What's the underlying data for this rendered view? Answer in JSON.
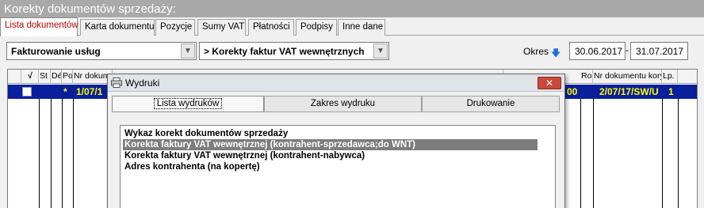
{
  "window": {
    "title": "Korekty dokumentów sprzedaży:"
  },
  "tabs": [
    {
      "label": "Lista dokumentów",
      "active": true
    },
    {
      "label": "Karta dokumentu"
    },
    {
      "label": "Pozycje"
    },
    {
      "label": "Sumy VAT"
    },
    {
      "label": "Płatności"
    },
    {
      "label": "Podpisy"
    },
    {
      "label": "Inne dane"
    }
  ],
  "filters": {
    "type_select": "Fakturowanie usług",
    "doc_select": "> Korekty faktur VAT wewnętrznych"
  },
  "period": {
    "label": "Okres",
    "from": "30.06.2017",
    "sep": "-",
    "to": "31.07.2017"
  },
  "grid": {
    "headers": [
      "√",
      "St",
      "Dé",
      "Po",
      "Nr dokum",
      "Ro:",
      "Nr dokumentu kory",
      "Lp."
    ],
    "row": {
      "star": "*",
      "date": "1/07/1",
      "ro": "00",
      "nr_kor": "2/07/17/SW/U",
      "lp": "1"
    }
  },
  "dialog": {
    "title": "Wydruki",
    "close": "✕",
    "tabs": [
      "Lista wydruków",
      "Zakres wydruku",
      "Drukowanie"
    ],
    "items": [
      "Wykaz korekt dokumentów sprzedaży",
      "Korekta faktury VAT wewnętrznej (kontrahent-sprzedawca;do WNT)",
      "Korekta faktury VAT wewnętrznej (kontrahent-nabywca)",
      "Adres kontrahenta (na kopertę)"
    ],
    "selected_index": 1
  },
  "icons": {
    "dropdown": "chevron-down-icon",
    "sort": "arrow-down-icon",
    "printer": "printer-icon",
    "close": "close-icon"
  },
  "colors": {
    "title_bar": "#a9a9a9",
    "active_tab_text": "#c00000",
    "selected_row_bg": "#0a1f9c",
    "selected_row_text": "#ffff00",
    "dialog_close": "#c9483a",
    "list_selected": "#7d7d7d"
  }
}
